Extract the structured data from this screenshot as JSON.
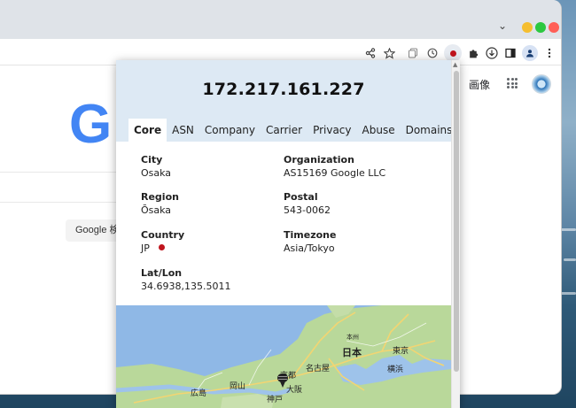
{
  "browser": {
    "toolbar_icons": [
      "share-icon",
      "star-icon",
      "copy-icon",
      "history-icon",
      "record-icon",
      "extensions-icon",
      "download-icon",
      "sidepanel-icon",
      "profile-icon",
      "menu-icon"
    ],
    "tabstrip": {
      "chevron": "⌄"
    }
  },
  "google": {
    "logo_letter": "G",
    "search_button": "Google 検索",
    "images_link": "画像"
  },
  "popup": {
    "ip": "172.217.161.227",
    "tabs": [
      {
        "label": "Core",
        "active": true
      },
      {
        "label": "ASN",
        "active": false
      },
      {
        "label": "Company",
        "active": false
      },
      {
        "label": "Carrier",
        "active": false
      },
      {
        "label": "Privacy",
        "active": false
      },
      {
        "label": "Abuse",
        "active": false
      },
      {
        "label": "Domains",
        "active": false
      }
    ],
    "fields": {
      "city": {
        "label": "City",
        "value": "Osaka"
      },
      "organization": {
        "label": "Organization",
        "value": "AS15169 Google LLC"
      },
      "region": {
        "label": "Region",
        "value": "Ōsaka"
      },
      "postal": {
        "label": "Postal",
        "value": "543-0062"
      },
      "country": {
        "label": "Country",
        "value": "JP"
      },
      "timezone": {
        "label": "Timezone",
        "value": "Asia/Tokyo"
      },
      "latlon": {
        "label": "Lat/Lon",
        "value": "34.6938,135.5011"
      }
    },
    "map_labels": {
      "japan": "日本",
      "tokyo": "東京",
      "yokohama": "横浜",
      "nagoya": "名古屋",
      "kyoto": "京都",
      "osaka": "大阪",
      "kobe": "神戸",
      "okayama": "岡山",
      "hiroshima": "広島",
      "honshu": "本州"
    }
  },
  "colors": {
    "popup_header": "#dde9f4",
    "map_water": "#8fb8e6",
    "map_land": "#b7d79a",
    "flag_red": "#c0151e",
    "google_blue": "#4285f4"
  }
}
